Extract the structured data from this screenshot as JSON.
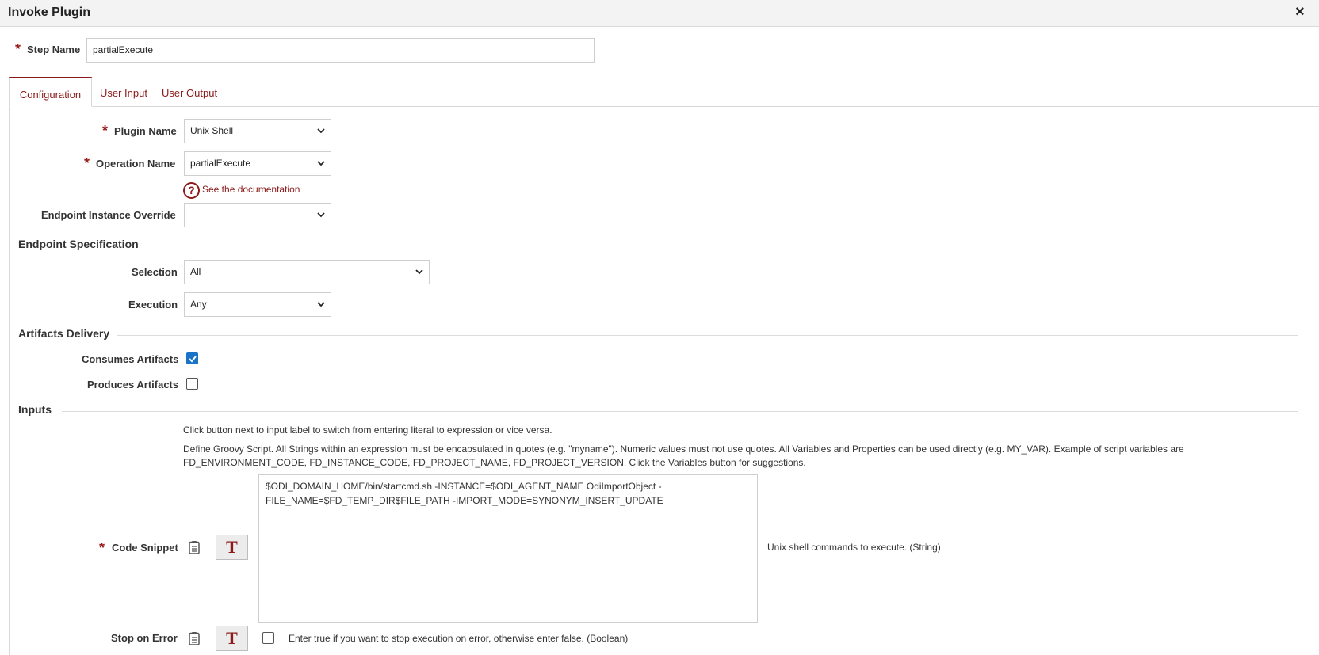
{
  "dialog": {
    "title": "Invoke Plugin",
    "close_icon": "×"
  },
  "step_name": {
    "label": "Step Name",
    "value": "partialExecute"
  },
  "tabs": [
    {
      "label": "Configuration",
      "active": true
    },
    {
      "label": "User Input",
      "active": false
    },
    {
      "label": "User Output",
      "active": false
    }
  ],
  "config": {
    "plugin_name": {
      "label": "Plugin Name",
      "value": "Unix Shell"
    },
    "operation_name": {
      "label": "Operation Name",
      "value": "partialExecute"
    },
    "doc_link": "See the documentation",
    "endpoint_override": {
      "label": "Endpoint Instance Override",
      "value": ""
    }
  },
  "endpoint_spec": {
    "title": "Endpoint Specification",
    "selection": {
      "label": "Selection",
      "value": "All"
    },
    "execution": {
      "label": "Execution",
      "value": "Any"
    }
  },
  "artifacts": {
    "title": "Artifacts Delivery",
    "consumes": {
      "label": "Consumes Artifacts",
      "checked": true
    },
    "produces": {
      "label": "Produces Artifacts",
      "checked": false
    }
  },
  "inputs": {
    "title": "Inputs",
    "hint1": "Click button next to input label to switch from entering literal to expression or vice versa.",
    "hint2": "Define Groovy Script. All Strings within an expression must be encapsulated in quotes (e.g. \"myname\"). Numeric values must not use quotes. All Variables and Properties can be used directly (e.g. MY_VAR). Example of script variables are FD_ENVIRONMENT_CODE, FD_INSTANCE_CODE, FD_PROJECT_NAME, FD_PROJECT_VERSION. Click the Variables button for suggestions.",
    "code_snippet": {
      "label": "Code Snippet",
      "value": "$ODI_DOMAIN_HOME/bin/startcmd.sh -INSTANCE=$ODI_AGENT_NAME OdiImportObject -FILE_NAME=$FD_TEMP_DIR$FILE_PATH -IMPORT_MODE=SYNONYM_INSERT_UPDATE",
      "description": "Unix shell commands to execute. (String)",
      "toggle_label": "T"
    },
    "stop_on_error": {
      "label": "Stop on Error",
      "checked": false,
      "description": "Enter true if you want to stop execution on error, otherwise enter false. (Boolean)",
      "toggle_label": "T"
    }
  },
  "colors": {
    "accent": "#8b1a1a",
    "checkbox": "#1a73c7"
  }
}
